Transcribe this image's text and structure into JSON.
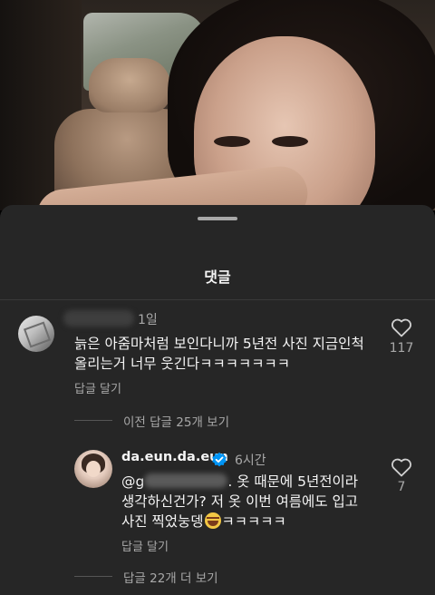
{
  "sheet": {
    "title": "댓글"
  },
  "comments": [
    {
      "time": "1일",
      "text_line1": "늙은 아줌마처럼 보인다니까 5년전 사진 지금인척",
      "text_line2": "올리는거 너무 웃긴다ㅋㅋㅋㅋㅋㅋㅋ",
      "reply_label": "답글 달기",
      "likes": "117",
      "view_replies": "이전 답글 25개 보기"
    }
  ],
  "reply": {
    "username": "da.eun.da.eun",
    "verified": true,
    "time": "6시간",
    "mention_prefix": "@g",
    "text_line1_suffix": ". 옷 때문에 5년전이라",
    "text_line2": "생각하신건가? 저 옷 이번 여름에도 입고",
    "text_line3_pre": "사진 찍었눙뎅",
    "text_line3_post": "ㅋㅋㅋㅋㅋ",
    "reply_label": "답글 달기",
    "likes": "7",
    "more_replies": "답글 22개 더 보기"
  },
  "icons": {
    "heart": "heart-outline-icon",
    "verified": "verified-badge-icon",
    "emoji": "grinning-sweat-emoji-icon"
  },
  "colors": {
    "sheet_bg": "#262626",
    "muted_text": "#a8a8a8",
    "verified_blue": "#0095f6"
  }
}
